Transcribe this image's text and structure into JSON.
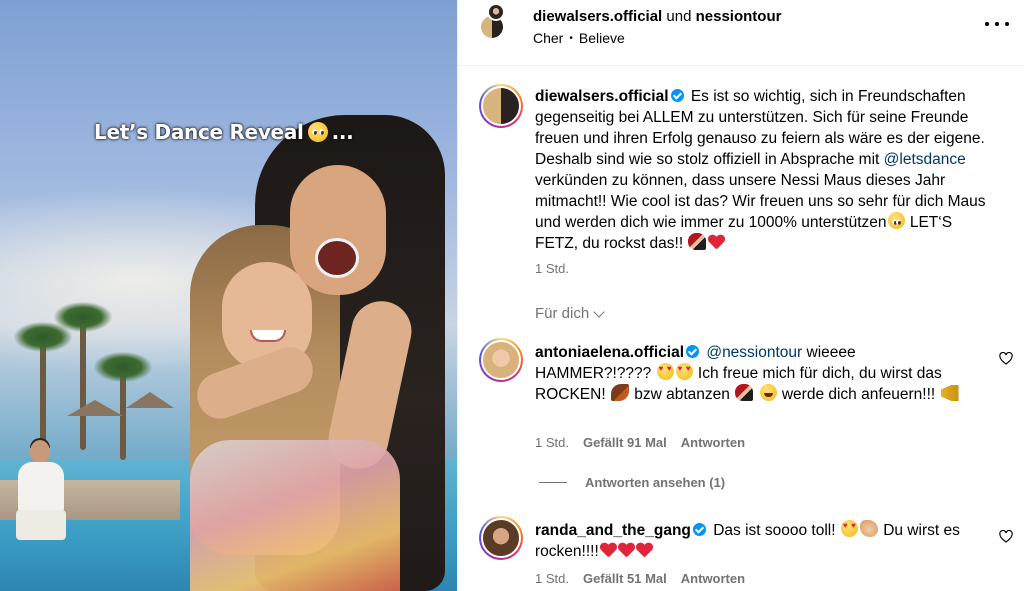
{
  "media": {
    "caption": "Let’s Dance Reveal",
    "caption_suffix": "..."
  },
  "header": {
    "user1": "diewalsers.official",
    "conjunction": "und",
    "user2": "nessiontour",
    "song_artist": "Cher",
    "separator": "•",
    "song_title": "Believe"
  },
  "post": {
    "username": "diewalsers.official",
    "verified": true,
    "text_part1": "Es ist so wichtig, sich in Freundschaften gegenseitig bei ALLEM zu unterstützen. Sich für seine Freunde freuen und ihren Erfolg genauso zu feiern als wäre es der eigene. Deshalb sind wie so stolz offiziell in Absprache mit",
    "mention": "@letsdance",
    "text_part2": "verkünden zu können, dass unsere Nessi Maus dieses Jahr mitmacht!! Wie cool ist das? Wir freuen uns so sehr für dich Maus und werden dich wie immer zu 1000% unterstützen",
    "text_part3": "LET‘S FETZ, du rockst das!!",
    "time": "1 Std."
  },
  "filter": {
    "label": "Für dich"
  },
  "comments": [
    {
      "username": "antoniaelena.official",
      "mention": "@nessiontour",
      "text_a": "wieeee HAMMER?!????",
      "text_b": "Ich freue mich für dich, du wirst das ROCKEN!",
      "text_c": "bzw abtanzen",
      "text_d": "werde dich anfeuern!!!",
      "time": "1 Std.",
      "likes": "Gefällt 91 Mal",
      "reply": "Antworten"
    },
    {
      "username": "randa_and_the_gang",
      "text_a": "Das ist soooo toll!",
      "text_b": "Du wirst es rocken!!!!",
      "time": "1 Std.",
      "likes": "Gefällt 51 Mal",
      "reply": "Antworten"
    }
  ],
  "view_replies": "Antworten ansehen (1)",
  "colors": {
    "verified": "#0095f6",
    "meta": "#737373",
    "mention": "#00376b"
  },
  "icons": [
    "more-icon",
    "verified-icon",
    "heart-icon",
    "chevron-down-icon"
  ]
}
